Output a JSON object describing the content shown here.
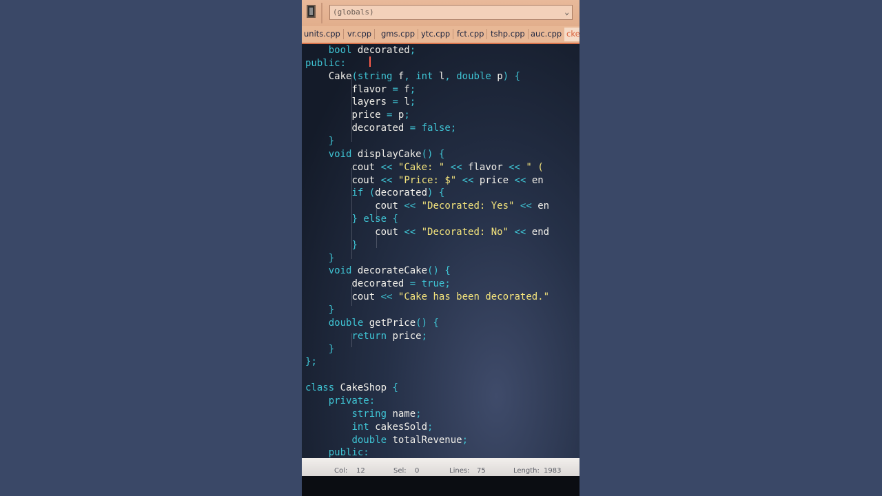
{
  "toolbar": {
    "scope_combo": "(globals)"
  },
  "tabs": [
    {
      "label": "units.cpp"
    },
    {
      "label": "vr.cpp"
    },
    {
      "label": "gms.cpp"
    },
    {
      "label": "ytc.cpp"
    },
    {
      "label": "fct.cpp"
    },
    {
      "label": "tshp.cpp"
    },
    {
      "label": "auc.cpp"
    },
    {
      "label": "cke"
    }
  ],
  "code_lines": [
    "    bool decorated;",
    "public:",
    "    Cake(string f, int l, double p) {",
    "        flavor = f;",
    "        layers = l;",
    "        price = p;",
    "        decorated = false;",
    "    }",
    "    void displayCake() {",
    "        cout << \"Cake: \" << flavor << \" (",
    "        cout << \"Price: $\" << price << en",
    "        if (decorated) {",
    "            cout << \"Decorated: Yes\" << en",
    "        } else {",
    "            cout << \"Decorated: No\" << end",
    "        }",
    "    }",
    "    void decorateCake() {",
    "        decorated = true;",
    "        cout << \"Cake has been decorated.\"",
    "    }",
    "    double getPrice() {",
    "        return price;",
    "    }",
    "};",
    "",
    "class CakeShop {",
    "    private:",
    "        string name;",
    "        int cakesSold;",
    "        double totalRevenue;",
    "    public:"
  ],
  "status": {
    "col_label": "Col:",
    "col_value": "12",
    "sel_label": "Sel:",
    "sel_value": "0",
    "lines_label": "Lines:",
    "lines_value": "75",
    "length_label": "Length:",
    "length_value": "1983"
  }
}
